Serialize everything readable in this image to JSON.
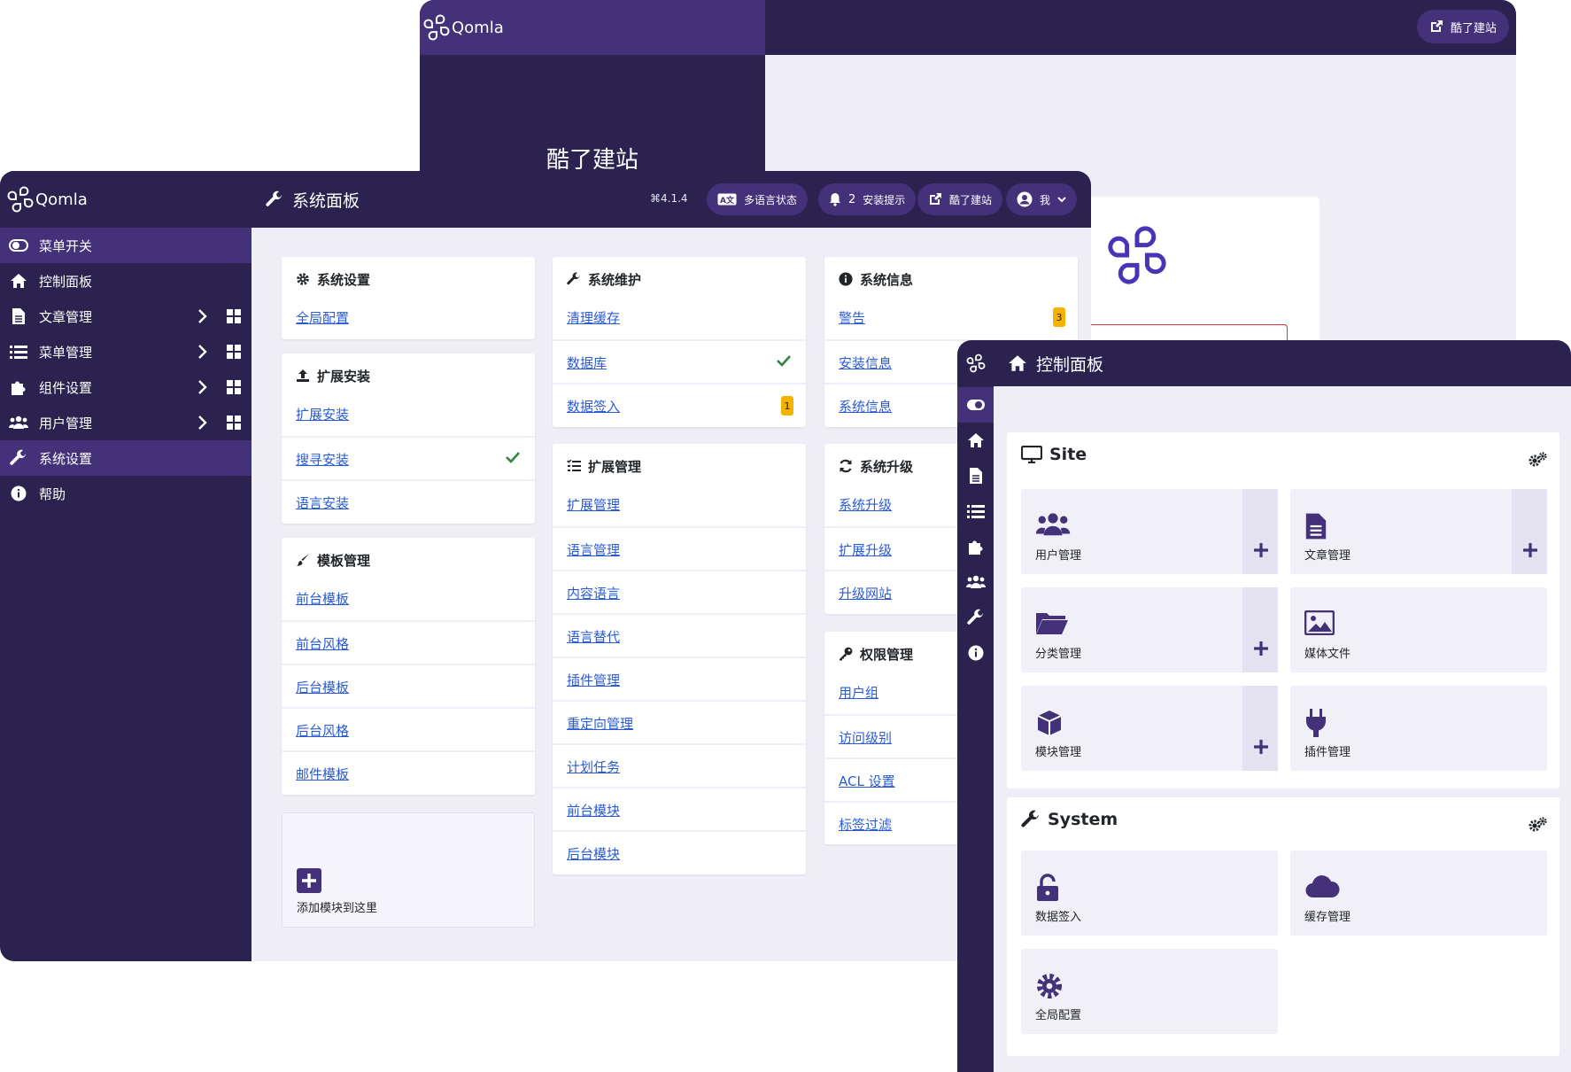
{
  "back_window": {
    "brand": "Qomla",
    "site_title": "酷了建站",
    "visit_label": "酷了建站"
  },
  "mid_window": {
    "brand": "Qomla",
    "sidebar": {
      "items": [
        {
          "label": "菜单开关",
          "icon": "toggle-icon",
          "active": true
        },
        {
          "label": "控制面板",
          "icon": "home-icon"
        },
        {
          "label": "文章管理",
          "icon": "file-icon",
          "expandable": true
        },
        {
          "label": "菜单管理",
          "icon": "list-icon",
          "expandable": true
        },
        {
          "label": "组件设置",
          "icon": "puzzle-icon",
          "expandable": true
        },
        {
          "label": "用户管理",
          "icon": "users-icon",
          "expandable": true
        },
        {
          "label": "系统设置",
          "icon": "wrench-icon",
          "active": true
        },
        {
          "label": "帮助",
          "icon": "info-icon"
        }
      ]
    },
    "header": {
      "title": "系统面板",
      "version": "4.1.4",
      "multilang_label": "多语言状态",
      "notices_count": "2",
      "notices_label": "安装提示",
      "visit_label": "酷了建站",
      "user_label": "我"
    },
    "cards": {
      "system_settings": {
        "title": "系统设置",
        "links": [
          "全局配置"
        ]
      },
      "install": {
        "title": "扩展安装",
        "links": [
          "扩展安装",
          "搜寻安装",
          "语言安装"
        ]
      },
      "templates": {
        "title": "模板管理",
        "links": [
          "前台模板",
          "前台风格",
          "后台模板",
          "后台风格",
          "邮件模板"
        ]
      },
      "add_module": {
        "label": "添加模块到这里"
      },
      "maintenance": {
        "title": "系统维护",
        "links": [
          "清理缓存",
          "数据库",
          "数据签入"
        ],
        "checkin_badge": "1"
      },
      "extensions": {
        "title": "扩展管理",
        "links": [
          "扩展管理",
          "语言管理",
          "内容语言",
          "语言替代",
          "插件管理",
          "重定向管理",
          "计划任务",
          "前台模块",
          "后台模块"
        ]
      },
      "info": {
        "title": "系统信息",
        "links": [
          "警告",
          "安装信息",
          "系统信息"
        ],
        "warning_badge": "3"
      },
      "update": {
        "title": "系统升级",
        "links": [
          "系统升级",
          "扩展升级",
          "升级网站"
        ]
      },
      "permissions": {
        "title": "权限管理",
        "links": [
          "用户组",
          "访问级别",
          "ACL 设置",
          "标签过滤"
        ]
      }
    }
  },
  "front_window": {
    "header": {
      "title": "控制面板"
    },
    "site": {
      "title": "Site",
      "tiles": [
        {
          "label": "用户管理",
          "icon": "users-icon",
          "add": true
        },
        {
          "label": "文章管理",
          "icon": "file-icon",
          "add": true
        },
        {
          "label": "分类管理",
          "icon": "folder-icon",
          "add": true
        },
        {
          "label": "媒体文件",
          "icon": "image-icon",
          "add": false
        },
        {
          "label": "模块管理",
          "icon": "cube-icon",
          "add": true
        },
        {
          "label": "插件管理",
          "icon": "plug-icon",
          "add": false
        }
      ]
    },
    "system": {
      "title": "System",
      "tiles": [
        {
          "label": "数据签入",
          "icon": "unlock-icon"
        },
        {
          "label": "缓存管理",
          "icon": "cloud-icon"
        },
        {
          "label": "全局配置",
          "icon": "gear-icon"
        }
      ]
    }
  },
  "colors": {
    "dark": "#2b2250",
    "accent": "#43317a",
    "page_bg": "#efedf6",
    "link": "#2a5bd7",
    "badge": "#f5b300",
    "check": "#2e8540"
  }
}
